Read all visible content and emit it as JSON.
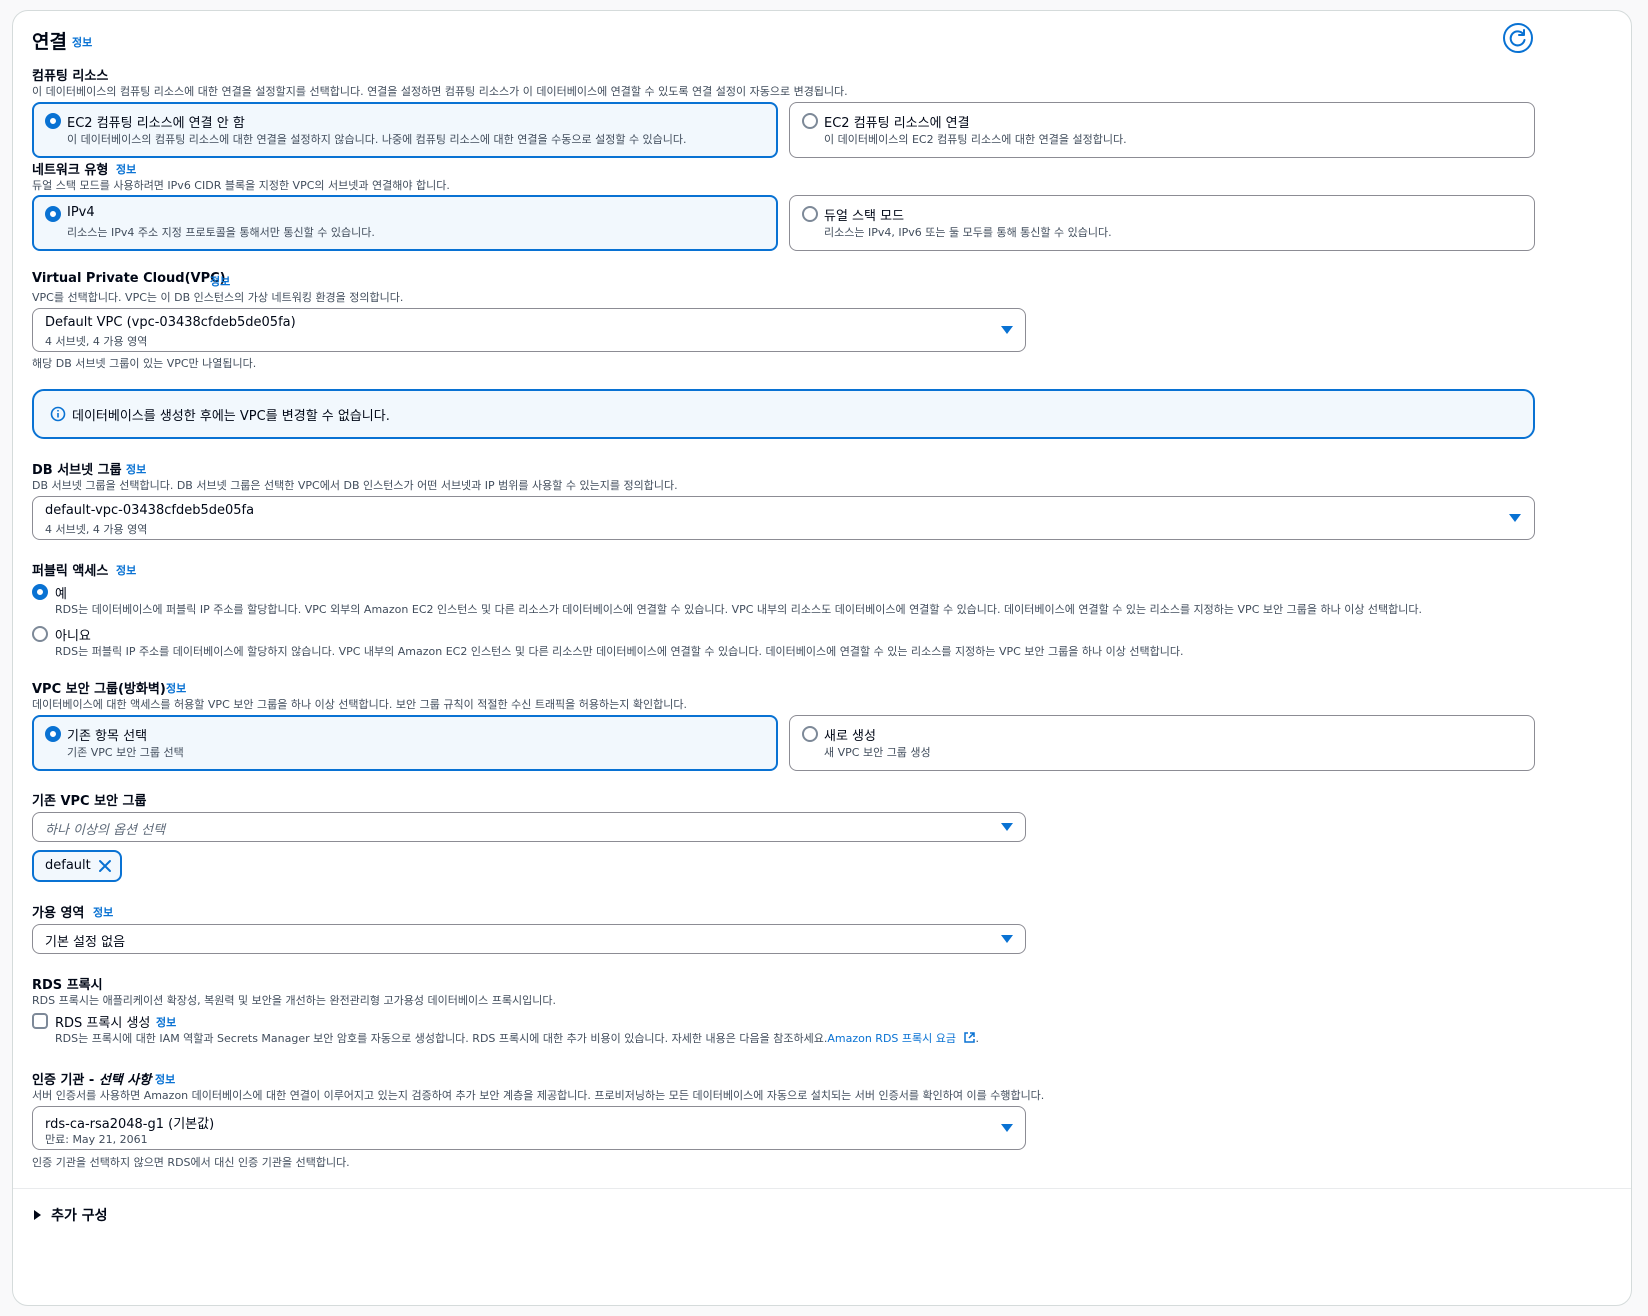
{
  "section": {
    "title": "연결",
    "info_link": "정보"
  },
  "compute": {
    "label": "컴퓨팅 리소스",
    "description": "이 데이터베이스의 컴퓨팅 리소스에 대한 연결을 설정할지를 선택합니다. 연결을 설정하면 컴퓨팅 리소스가 이 데이터베이스에 연결할 수 있도록 연결 설정이 자동으로 변경됩니다.",
    "options": [
      {
        "title": "EC2 컴퓨팅 리소스에 연결 안 함",
        "description": "이 데이터베이스의 컴퓨팅 리소스에 대한 연결을 설정하지 않습니다. 나중에 컴퓨팅 리소스에 대한 연결을 수동으로 설정할 수 있습니다.",
        "selected": true
      },
      {
        "title": "EC2 컴퓨팅 리소스에 연결",
        "description": "이 데이터베이스의 EC2 컴퓨팅 리소스에 대한 연결을 설정합니다.",
        "selected": false
      }
    ]
  },
  "network": {
    "label": "네트워크 유형",
    "info_link": "정보",
    "description": "듀얼 스택 모드를 사용하려면 IPv6 CIDR 블록을 지정한 VPC의 서브넷과 연결해야 합니다.",
    "options": [
      {
        "title": "IPv4",
        "description": "리소스는 IPv4 주소 지정 프로토콜을 통해서만 통신할 수 있습니다.",
        "selected": true
      },
      {
        "title": "듀얼 스택 모드",
        "description": "리소스는 IPv4, IPv6 또는 둘 모두를 통해 통신할 수 있습니다.",
        "selected": false
      }
    ]
  },
  "vpc": {
    "label": "Virtual Private Cloud(VPC)",
    "info_link": "정보",
    "description": "VPC를 선택합니다. VPC는 이 DB 인스턴스의 가상 네트워킹 환경을 정의합니다.",
    "value": "Default VPC (vpc-03438cfdeb5de05fa)",
    "sub": "4 서브넷, 4 가용 영역",
    "hint": "해당 DB 서브넷 그룹이 있는 VPC만 나열됩니다."
  },
  "alert": {
    "icon": "info-icon",
    "text": "데이터베이스를 생성한 후에는 VPC를 변경할 수 없습니다."
  },
  "subnet": {
    "label": "DB 서브넷 그룹",
    "info_link": "정보",
    "description": "DB 서브넷 그룹을 선택합니다. DB 서브넷 그룹은 선택한 VPC에서 DB 인스턴스가 어떤 서브넷과 IP 범위를 사용할 수 있는지를 정의합니다.",
    "value": "default-vpc-03438cfdeb5de05fa",
    "sub": "4 서브넷, 4 가용 영역"
  },
  "public_access": {
    "label": "퍼블릭 액세스",
    "info_link": "정보",
    "options": [
      {
        "title": "예",
        "description": "RDS는 데이터베이스에 퍼블릭 IP 주소를 할당합니다. VPC 외부의 Amazon EC2 인스턴스 및 다른 리소스가 데이터베이스에 연결할 수 있습니다. VPC 내부의 리소스도 데이터베이스에 연결할 수 있습니다. 데이터베이스에 연결할 수 있는 리소스를 지정하는 VPC 보안 그룹을 하나 이상 선택합니다.",
        "selected": true
      },
      {
        "title": "아니요",
        "description": "RDS는 퍼블릭 IP 주소를 데이터베이스에 할당하지 않습니다. VPC 내부의 Amazon EC2 인스턴스 및 다른 리소스만 데이터베이스에 연결할 수 있습니다. 데이터베이스에 연결할 수 있는 리소스를 지정하는 VPC 보안 그룹을 하나 이상 선택합니다.",
        "selected": false
      }
    ]
  },
  "security_group": {
    "label": "VPC 보안 그룹(방화벽)",
    "info_link": "정보",
    "description": "데이터베이스에 대한 액세스를 허용할 VPC 보안 그룹을 하나 이상 선택합니다. 보안 그룹 규칙이 적절한 수신 트래픽을 허용하는지 확인합니다.",
    "options": [
      {
        "title": "기존 항목 선택",
        "description": "기존 VPC 보안 그룹 선택",
        "selected": true
      },
      {
        "title": "새로 생성",
        "description": "새 VPC 보안 그룹 생성",
        "selected": false
      }
    ]
  },
  "existing_sg": {
    "label": "기존 VPC 보안 그룹",
    "placeholder": "하나 이상의 옵션 선택",
    "tokens": [
      "default"
    ]
  },
  "az": {
    "label": "가용 영역",
    "info_link": "정보",
    "value": "기본 설정 없음"
  },
  "proxy": {
    "label": "RDS 프록시",
    "description": "RDS 프록시는 애플리케이션 확장성, 복원력 및 보안을 개선하는 완전관리형 고가용성 데이터베이스 프록시입니다.",
    "checkbox_label": "RDS 프록시 생성",
    "info_link": "정보",
    "checked": false,
    "checkbox_desc": "RDS는 프록시에 대한 IAM 역할과 Secrets Manager 보안 암호를 자동으로 생성합니다. RDS 프록시에 대한 추가 비용이 있습니다. 자세한 내용은 다음을 참조하세요.",
    "pricing_link": "Amazon RDS 프록시 요금",
    "trailing": "."
  },
  "ca": {
    "label": "인증 기관 - ",
    "label_optional": "선택 사항",
    "info_link": "정보",
    "description": "서버 인증서를 사용하면 Amazon 데이터베이스에 대한 연결이 이루어지고 있는지 검증하여 추가 보안 계층을 제공합니다. 프로비저닝하는 모든 데이터베이스에 자동으로 설치되는 서버 인증서를 확인하여 이를 수행합니다.",
    "value": "rds-ca-rsa2048-g1 (기본값)",
    "sub": "만료: May 21, 2061",
    "hint": "인증 기관을 선택하지 않으면 RDS에서 대신 인증 기관을 선택합니다."
  },
  "additional": {
    "label": "추가 구성"
  },
  "colors": {
    "accent": "#0972d3",
    "selected_bg": "#f2f8fd",
    "text": "#000716",
    "muted": "#414d5c"
  }
}
